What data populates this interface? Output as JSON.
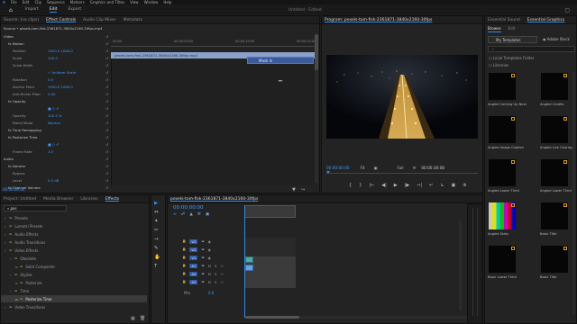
{
  "menu": {
    "items": [
      "File",
      "Edit",
      "Clip",
      "Sequence",
      "Markers",
      "Graphics and Titles",
      "View",
      "Window",
      "Help"
    ]
  },
  "workspace": {
    "tabs": [
      "Import",
      "Edit",
      "Export"
    ],
    "active_index": 1,
    "doc_title": "Untitled - Edited"
  },
  "effect_controls": {
    "tabs": [
      "Source: (no clips)",
      "Effect Controls",
      "Audio Clip Mixer",
      "Metadata"
    ],
    "active_index": 1,
    "source_row": "Source • pexels-tom-fisk-2361871-3840x2160-30fps.mp4",
    "clip_bar": "pexels-tom-fisk-2361871-3840x2160-30fps.mp4",
    "ruler": [
      "00:00",
      "00:00:05:00",
      "00:00:10:00",
      "00:00:15:00"
    ],
    "tooltip": "Mask In",
    "timecode": "00:00:00:00",
    "rows": [
      {
        "label": "Video",
        "indent": 0,
        "value": ""
      },
      {
        "label": "fx Motion",
        "indent": 1,
        "value": ""
      },
      {
        "label": "Position",
        "indent": 2,
        "value": "1920.0   1080.0"
      },
      {
        "label": "Scale",
        "indent": 2,
        "value": "100.0"
      },
      {
        "label": "Scale Width",
        "indent": 2,
        "value": ""
      },
      {
        "label": "",
        "indent": 2,
        "value": "✓ Uniform Scale"
      },
      {
        "label": "Rotation",
        "indent": 2,
        "value": "0.0"
      },
      {
        "label": "Anchor Point",
        "indent": 2,
        "value": "1920.0   1080.0"
      },
      {
        "label": "Anti-flicker Filter",
        "indent": 2,
        "value": "0.00"
      },
      {
        "label": "fx Opacity",
        "indent": 1,
        "value": ""
      },
      {
        "label": "",
        "indent": 2,
        "value": "■ ○ ✐"
      },
      {
        "label": "Opacity",
        "indent": 2,
        "value": "100.0 %"
      },
      {
        "label": "Blend Mode",
        "indent": 2,
        "value": "Normal"
      },
      {
        "label": "fx Time Remapping",
        "indent": 1,
        "value": ""
      },
      {
        "label": "fx Posterize Time",
        "indent": 1,
        "value": ""
      },
      {
        "label": "",
        "indent": 2,
        "value": "■ ○ ✐"
      },
      {
        "label": "Frame Rate",
        "indent": 2,
        "value": "1.0"
      },
      {
        "label": "Audio",
        "indent": 0,
        "value": ""
      },
      {
        "label": "fx Volume",
        "indent": 1,
        "value": ""
      },
      {
        "label": "Bypass",
        "indent": 2,
        "value": ""
      },
      {
        "label": "Level",
        "indent": 2,
        "value": "0.0 dB"
      },
      {
        "label": "fx Channel Volume",
        "indent": 1,
        "value": ""
      }
    ]
  },
  "program": {
    "title": "Program: pexels-tom-fisk-2361871-3840x2160-30fps",
    "timecode_left": "00:00:00:00",
    "fit": "Fit",
    "quality": "Full",
    "timecode_right": "00:00:30:08",
    "transport": [
      "{",
      "}",
      "|←",
      "◀|",
      "▶",
      "|▶",
      "→|",
      "↵",
      "↳",
      "▣",
      "⊕"
    ]
  },
  "project": {
    "tabs": [
      "Project: Untitled",
      "Media Browser",
      "Libraries",
      "Effects"
    ],
    "active_index": 3,
    "search_value": "pos",
    "tree": [
      {
        "label": "Presets",
        "indent": 0
      },
      {
        "label": "Lumetri Presets",
        "indent": 0
      },
      {
        "label": "Audio Effects",
        "indent": 0
      },
      {
        "label": "Audio Transitions",
        "indent": 0
      },
      {
        "label": "Video Effects",
        "indent": 0
      },
      {
        "label": "Obsolete",
        "indent": 1
      },
      {
        "label": "Solid Composite",
        "indent": 2
      },
      {
        "label": "Stylize",
        "indent": 1
      },
      {
        "label": "Posterize",
        "indent": 2
      },
      {
        "label": "Time",
        "indent": 1
      },
      {
        "label": "Posterize Time",
        "indent": 2
      },
      {
        "label": "Video Transitions",
        "indent": 0
      }
    ],
    "selected_index": 10
  },
  "timeline": {
    "title": "pexels-tom-fisk-2361871-3840x2160-30fps",
    "timecode": "00:00:00:00",
    "tracks": [
      {
        "name": "V3",
        "type": "video"
      },
      {
        "name": "V2",
        "type": "video"
      },
      {
        "name": "V1",
        "type": "video"
      },
      {
        "name": "A1",
        "type": "audio"
      },
      {
        "name": "A2",
        "type": "audio"
      },
      {
        "name": "A3",
        "type": "audio"
      }
    ],
    "mix_label": "Mix",
    "mix_value": "0.0",
    "tools": [
      "▶",
      "⇔",
      "✦",
      "✂",
      "→",
      "✎",
      "✋",
      "T"
    ]
  },
  "essential": {
    "tabs": [
      "Essential Sound",
      "Essential Graphics"
    ],
    "active_index": 1,
    "subtabs": [
      "Browse",
      "Edit"
    ],
    "dropdown": "My Templates",
    "adobe_stock": "Adobe Stock",
    "search_placeholder": "",
    "local_templates": "Local Templates Folder",
    "libraries": "Libraries",
    "templates": [
      {
        "name": "Angled Coming Up Next",
        "style": "dark"
      },
      {
        "name": "Angled Credits",
        "style": "dark"
      },
      {
        "name": "Angled Image Caption",
        "style": "dark"
      },
      {
        "name": "Angled Live Overlay",
        "style": "dark"
      },
      {
        "name": "Angled Lower Third",
        "style": "dark"
      },
      {
        "name": "Angled Lower Third",
        "style": "dark"
      },
      {
        "name": "Angled Stats",
        "style": "bars"
      },
      {
        "name": "Basic Title",
        "style": "dark"
      },
      {
        "name": "Basic Lower Third",
        "style": "dark"
      },
      {
        "name": "Basic Title",
        "style": "dark"
      }
    ]
  },
  "colors": {
    "accent": "#2d8ceb",
    "blue_text": "#3e9bff",
    "panel": "#232323"
  }
}
